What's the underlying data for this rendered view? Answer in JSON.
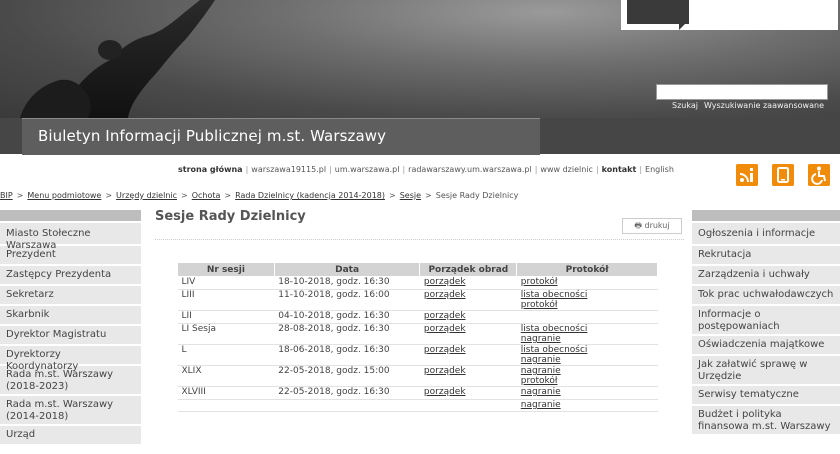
{
  "header": {
    "title": "Biuletyn Informacji Publicznej m.st. Warszawy",
    "search": {
      "value": "",
      "search_label": "Szukaj",
      "advanced_label": "Wyszukiwanie zaawansowane"
    },
    "top_links": [
      {
        "label": "strona główna",
        "bold": true
      },
      {
        "label": "warszawa19115.pl",
        "bold": false
      },
      {
        "label": "um.warszawa.pl",
        "bold": false
      },
      {
        "label": "radawarszawy.um.warszawa.pl",
        "bold": false
      },
      {
        "label": "www dzielnic",
        "bold": false
      },
      {
        "label": "kontakt",
        "bold": true
      },
      {
        "label": "English",
        "bold": false
      }
    ],
    "icons": [
      "rss-info-icon",
      "mobile-icon",
      "accessibility-icon"
    ]
  },
  "breadcrumb": [
    "BIP",
    "Menu podmiotowe",
    "Urzędy dzielnic",
    "Ochota",
    "Rada Dzielnicy (kadencja 2014-2018)",
    "Sesje",
    "Sesje Rady Dzielnicy"
  ],
  "left_nav": [
    "Miasto Stołeczne Warszawa",
    "Prezydent",
    "Zastępcy Prezydenta",
    "Sekretarz",
    "Skarbnik",
    "Dyrektor Magistratu",
    "Dyrektorzy Koordynatorzy",
    "Rada m.st. Warszawy (2018-2023)",
    "Rada m.st. Warszawy (2014-2018)",
    "Urząd"
  ],
  "right_nav": [
    "Ogłoszenia i informacje",
    "Rekrutacja",
    "Zarządzenia i uchwały",
    "Tok prac uchwałodawczych",
    "Informacje o postępowaniach",
    "Oświadczenia majątkowe",
    "Jak załatwić sprawę w Urzędzie",
    "Serwisy tematyczne",
    "Budżet i polityka finansowa m.st. Warszawy"
  ],
  "main": {
    "title": "Sesje Rady Dzielnicy",
    "print_label": "drukuj",
    "table": {
      "headers": [
        "Nr sesji",
        "Data",
        "Porządek obrad",
        "Protokół"
      ],
      "rows": [
        {
          "nr": "LIV",
          "date": "18-10-2018, godz. 16:30",
          "agenda": "porządek",
          "protocol": [
            "protokół"
          ]
        },
        {
          "nr": "LIII",
          "date": "11-10-2018, godz. 16:00",
          "agenda": "porządek",
          "protocol": [
            "lista obecności",
            "protokół"
          ]
        },
        {
          "nr": "LII",
          "date": "04-10-2018, godz. 16:30",
          "agenda": "porządek",
          "protocol": []
        },
        {
          "nr": "LI Sesja",
          "date": "28-08-2018, godz. 16:30",
          "agenda": "porządek",
          "protocol": [
            "lista obecności",
            "nagranie"
          ]
        },
        {
          "nr": "L",
          "date": "18-06-2018, godz. 16:30",
          "agenda": "porządek",
          "protocol": [
            "lista obecności",
            "nagranie"
          ]
        },
        {
          "nr": "XLIX",
          "date": "22-05-2018, godz. 15:00",
          "agenda": "porządek",
          "protocol": [
            "nagranie",
            "protokół"
          ]
        },
        {
          "nr": "XLVIII",
          "date": "22-05-2018, godz. 16:30",
          "agenda": "porządek",
          "protocol": [
            "nagranie"
          ]
        },
        {
          "nr": "",
          "date": "",
          "agenda": "",
          "protocol": [
            "nagranie"
          ]
        }
      ]
    }
  }
}
